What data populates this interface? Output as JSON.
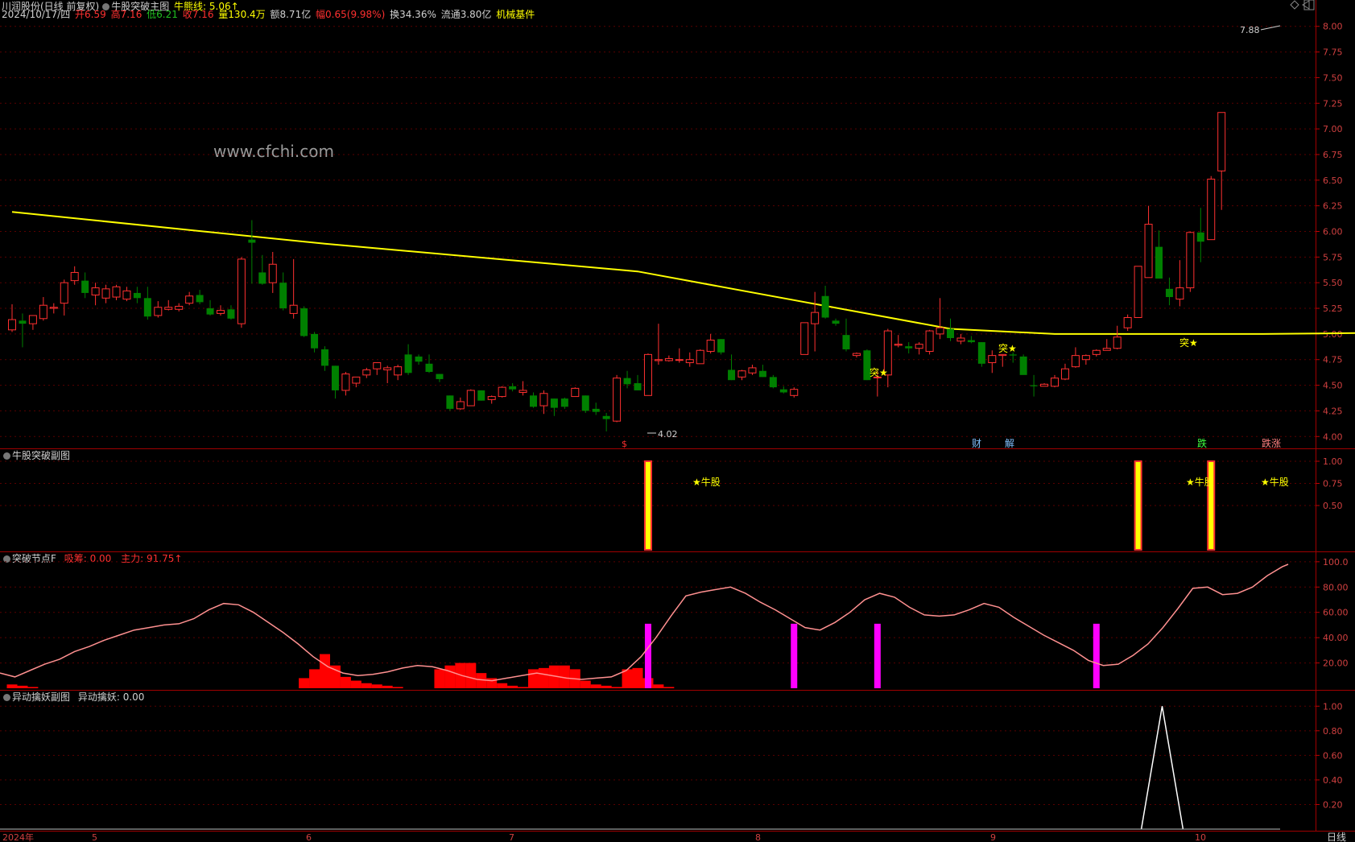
{
  "header": {
    "stock": "川润股份(日线 前复权)",
    "main_indicator": "牛股突破主图",
    "bull_line": "牛熊线: 5.06↑",
    "date": "2024/10/17/四",
    "open": "开6.59",
    "high": "高7.16",
    "low": "低6.21",
    "close": "收7.16",
    "volume": "量130.4万",
    "amount": "额8.71亿",
    "change": "幅0.65(9.98%)",
    "turnover": "换34.36%",
    "float": "流通3.80亿",
    "sector": "机械基件"
  },
  "watermark": "www.cfchi.com",
  "annotations": {
    "max_price": "7.88",
    "min_price": "4.02",
    "breakout": "突★",
    "bull": "★牛股",
    "tags": [
      "$",
      "财",
      "解",
      "跌",
      "跌涨"
    ]
  },
  "panels": {
    "sub1_title": "牛股突破副图",
    "sub2_title": "突破节点F",
    "sub2_values": [
      "吸筹: 0.00",
      "主力: 91.75↑"
    ],
    "sub3_title": "异动擒妖副图",
    "sub3_value": "异动擒妖: 0.00"
  },
  "x_axis": {
    "labels": [
      "2024年",
      "5",
      "6",
      "7",
      "8",
      "9",
      "10"
    ],
    "period_label": "日线"
  },
  "colors": {
    "up": "#ff3030",
    "down": "#008000",
    "ma": "#ffff00",
    "magenta": "#ff00ff",
    "axis": "#c00000"
  },
  "chart_data": [
    {
      "type": "candlestick",
      "title": "牛股突破主图",
      "ylim": [
        3.9,
        8.1
      ],
      "y_ticks": [
        4.0,
        4.25,
        4.5,
        4.75,
        5.0,
        5.25,
        5.5,
        5.75,
        6.0,
        6.25,
        6.5,
        6.75,
        7.0,
        7.25,
        7.5,
        7.75,
        8.0
      ],
      "ohlc": [
        [
          5.04,
          5.29,
          5.02,
          5.14
        ],
        [
          5.13,
          5.2,
          4.87,
          5.1
        ],
        [
          5.1,
          5.14,
          5.04,
          5.18
        ],
        [
          5.15,
          5.36,
          5.13,
          5.28
        ],
        [
          5.25,
          5.3,
          5.2,
          5.26
        ],
        [
          5.3,
          5.53,
          5.18,
          5.5
        ],
        [
          5.52,
          5.66,
          5.48,
          5.6
        ],
        [
          5.52,
          5.6,
          5.35,
          5.4
        ],
        [
          5.38,
          5.5,
          5.28,
          5.45
        ],
        [
          5.35,
          5.48,
          5.3,
          5.44
        ],
        [
          5.36,
          5.48,
          5.33,
          5.46
        ],
        [
          5.34,
          5.46,
          5.32,
          5.42
        ],
        [
          5.4,
          5.46,
          5.3,
          5.35
        ],
        [
          5.35,
          5.46,
          5.14,
          5.17
        ],
        [
          5.18,
          5.32,
          5.16,
          5.26
        ],
        [
          5.24,
          5.33,
          5.23,
          5.26
        ],
        [
          5.24,
          5.3,
          5.22,
          5.27
        ],
        [
          5.3,
          5.41,
          5.28,
          5.37
        ],
        [
          5.38,
          5.43,
          5.29,
          5.31
        ],
        [
          5.25,
          5.33,
          5.18,
          5.19
        ],
        [
          5.2,
          5.28,
          5.18,
          5.23
        ],
        [
          5.24,
          5.28,
          5.14,
          5.15
        ],
        [
          5.1,
          5.75,
          5.06,
          5.73
        ],
        [
          5.92,
          6.11,
          5.49,
          5.89
        ],
        [
          5.6,
          5.77,
          5.48,
          5.49
        ],
        [
          5.5,
          5.8,
          5.4,
          5.68
        ],
        [
          5.5,
          5.6,
          5.23,
          5.25
        ],
        [
          5.2,
          5.73,
          5.15,
          5.28
        ],
        [
          5.25,
          5.27,
          4.97,
          4.98
        ],
        [
          5.0,
          5.02,
          4.82,
          4.86
        ],
        [
          4.85,
          4.88,
          4.64,
          4.69
        ],
        [
          4.69,
          4.69,
          4.37,
          4.45
        ],
        [
          4.45,
          4.63,
          4.4,
          4.61
        ],
        [
          4.52,
          4.57,
          4.48,
          4.58
        ],
        [
          4.6,
          4.67,
          4.57,
          4.65
        ],
        [
          4.66,
          4.72,
          4.6,
          4.72
        ],
        [
          4.65,
          4.69,
          4.52,
          4.67
        ],
        [
          4.6,
          4.7,
          4.55,
          4.68
        ],
        [
          4.8,
          4.9,
          4.6,
          4.62
        ],
        [
          4.78,
          4.8,
          4.7,
          4.73
        ],
        [
          4.71,
          4.8,
          4.62,
          4.63
        ],
        [
          4.61,
          4.61,
          4.53,
          4.56
        ],
        [
          4.4,
          4.4,
          4.25,
          4.27
        ],
        [
          4.27,
          4.38,
          4.26,
          4.34
        ],
        [
          4.3,
          4.46,
          4.3,
          4.45
        ],
        [
          4.45,
          4.45,
          4.35,
          4.35
        ],
        [
          4.36,
          4.4,
          4.32,
          4.39
        ],
        [
          4.39,
          4.49,
          4.38,
          4.48
        ],
        [
          4.49,
          4.52,
          4.44,
          4.46
        ],
        [
          4.43,
          4.54,
          4.4,
          4.45
        ],
        [
          4.4,
          4.43,
          4.28,
          4.29
        ],
        [
          4.3,
          4.45,
          4.22,
          4.42
        ],
        [
          4.37,
          4.37,
          4.2,
          4.28
        ],
        [
          4.37,
          4.38,
          4.27,
          4.29
        ],
        [
          4.39,
          4.48,
          4.39,
          4.47
        ],
        [
          4.4,
          4.4,
          4.23,
          4.25
        ],
        [
          4.27,
          4.33,
          4.21,
          4.24
        ],
        [
          4.2,
          4.23,
          4.05,
          4.17
        ],
        [
          4.15,
          4.6,
          4.14,
          4.57
        ],
        [
          4.57,
          4.64,
          4.47,
          4.51
        ],
        [
          4.52,
          4.6,
          4.45,
          4.45
        ],
        [
          4.4,
          4.81,
          4.4,
          4.8
        ],
        [
          4.74,
          5.1,
          4.7,
          4.75
        ],
        [
          4.74,
          4.79,
          4.73,
          4.76
        ],
        [
          4.75,
          4.86,
          4.72,
          4.75
        ],
        [
          4.72,
          4.82,
          4.68,
          4.75
        ],
        [
          4.71,
          4.85,
          4.71,
          4.84
        ],
        [
          4.83,
          5.0,
          4.81,
          4.94
        ],
        [
          4.95,
          4.95,
          4.8,
          4.82
        ],
        [
          4.65,
          4.8,
          4.55,
          4.55
        ],
        [
          4.58,
          4.65,
          4.55,
          4.64
        ],
        [
          4.62,
          4.7,
          4.6,
          4.67
        ],
        [
          4.64,
          4.7,
          4.58,
          4.58
        ],
        [
          4.58,
          4.6,
          4.47,
          4.48
        ],
        [
          4.46,
          4.49,
          4.42,
          4.43
        ],
        [
          4.4,
          4.48,
          4.38,
          4.46
        ],
        [
          4.8,
          5.09,
          4.8,
          5.11
        ],
        [
          5.1,
          5.41,
          4.83,
          5.21
        ],
        [
          5.37,
          5.47,
          5.15,
          5.16
        ],
        [
          5.13,
          5.15,
          5.08,
          5.1
        ],
        [
          4.99,
          5.15,
          4.83,
          4.85
        ],
        [
          4.79,
          4.82,
          4.77,
          4.81
        ],
        [
          4.84,
          4.85,
          4.55,
          4.55
        ],
        [
          4.58,
          4.64,
          4.39,
          4.58
        ],
        [
          4.6,
          5.05,
          4.48,
          5.03
        ],
        [
          4.89,
          4.99,
          4.87,
          4.9
        ],
        [
          4.88,
          4.92,
          4.81,
          4.86
        ],
        [
          4.86,
          4.92,
          4.8,
          4.9
        ],
        [
          4.83,
          5.04,
          4.8,
          5.03
        ],
        [
          5.0,
          5.35,
          4.95,
          5.06
        ],
        [
          5.05,
          5.15,
          4.93,
          4.96
        ],
        [
          4.93,
          5.0,
          4.9,
          4.96
        ],
        [
          4.94,
          4.98,
          4.91,
          4.92
        ],
        [
          4.92,
          4.92,
          4.68,
          4.71
        ],
        [
          4.72,
          4.84,
          4.62,
          4.79
        ],
        [
          4.79,
          4.8,
          4.68,
          4.8
        ],
        [
          4.8,
          4.82,
          4.72,
          4.79
        ],
        [
          4.78,
          4.8,
          4.61,
          4.6
        ],
        [
          4.5,
          4.6,
          4.39,
          4.49
        ],
        [
          4.49,
          4.52,
          4.5,
          4.51
        ],
        [
          4.49,
          4.6,
          4.48,
          4.57
        ],
        [
          4.56,
          4.71,
          4.55,
          4.66
        ],
        [
          4.68,
          4.87,
          4.67,
          4.79
        ],
        [
          4.75,
          4.8,
          4.7,
          4.79
        ],
        [
          4.8,
          4.85,
          4.78,
          4.84
        ],
        [
          4.84,
          4.95,
          4.84,
          4.86
        ],
        [
          4.86,
          5.08,
          4.85,
          4.97
        ],
        [
          5.06,
          5.19,
          5.03,
          5.16
        ],
        [
          5.16,
          5.61,
          5.16,
          5.66
        ],
        [
          5.55,
          6.25,
          5.6,
          6.07
        ],
        [
          5.85,
          6.01,
          5.6,
          5.54
        ],
        [
          5.44,
          5.55,
          5.28,
          5.36
        ],
        [
          5.34,
          5.72,
          5.27,
          5.45
        ],
        [
          5.45,
          6.0,
          5.41,
          5.99
        ],
        [
          5.99,
          6.23,
          5.7,
          5.9
        ],
        [
          5.92,
          6.54,
          5.92,
          6.51
        ],
        [
          6.59,
          7.16,
          6.21,
          7.16
        ]
      ],
      "ma_line": [
        [
          0,
          6.19
        ],
        [
          30,
          5.88
        ],
        [
          60,
          5.61
        ],
        [
          90,
          5.05
        ],
        [
          100,
          5.0
        ],
        [
          120,
          5.0
        ],
        [
          130,
          5.01
        ],
        [
          140,
          5.07
        ]
      ]
    },
    {
      "type": "bar",
      "title": "牛股突破副图",
      "ylim": [
        0,
        1.1
      ],
      "y_ticks": [
        0.5,
        0.75,
        1.0
      ],
      "bars": [
        [
          61,
          1
        ],
        [
          108,
          1
        ],
        [
          115,
          1
        ]
      ]
    },
    {
      "type": "line",
      "title": "突破节点F",
      "ylim": [
        0,
        105
      ],
      "y_ticks": [
        20.0,
        40.0,
        60.0,
        80.0,
        100.0
      ],
      "line": [
        [
          0,
          12
        ],
        [
          5,
          9
        ],
        [
          10,
          14
        ],
        [
          15,
          19
        ],
        [
          20,
          23
        ],
        [
          25,
          29
        ],
        [
          30,
          33
        ],
        [
          35,
          38
        ],
        [
          40,
          42
        ],
        [
          45,
          46
        ],
        [
          50,
          48
        ],
        [
          55,
          50
        ],
        [
          60,
          51
        ],
        [
          65,
          55
        ],
        [
          70,
          62
        ],
        [
          75,
          67
        ],
        [
          80,
          66
        ],
        [
          85,
          60
        ],
        [
          90,
          52
        ],
        [
          95,
          44
        ],
        [
          100,
          35
        ],
        [
          105,
          25
        ],
        [
          110,
          17
        ],
        [
          115,
          12
        ],
        [
          120,
          10
        ],
        [
          125,
          11
        ],
        [
          130,
          13
        ],
        [
          135,
          16
        ],
        [
          140,
          18
        ],
        [
          145,
          17
        ],
        [
          150,
          14
        ],
        [
          155,
          10
        ],
        [
          160,
          7
        ],
        [
          165,
          6
        ],
        [
          170,
          8
        ],
        [
          175,
          10
        ],
        [
          180,
          12
        ],
        [
          185,
          10
        ],
        [
          190,
          8
        ],
        [
          195,
          7
        ],
        [
          200,
          8
        ],
        [
          205,
          9
        ],
        [
          210,
          14
        ],
        [
          215,
          25
        ],
        [
          220,
          40
        ],
        [
          225,
          57
        ],
        [
          230,
          73
        ],
        [
          235,
          76
        ],
        [
          240,
          78
        ],
        [
          245,
          80
        ],
        [
          250,
          75
        ],
        [
          255,
          68
        ],
        [
          260,
          62
        ],
        [
          265,
          55
        ],
        [
          270,
          48
        ],
        [
          275,
          46
        ],
        [
          280,
          52
        ],
        [
          285,
          60
        ],
        [
          290,
          70
        ],
        [
          295,
          75
        ],
        [
          300,
          72
        ],
        [
          305,
          64
        ],
        [
          310,
          58
        ],
        [
          315,
          57
        ],
        [
          320,
          58
        ],
        [
          325,
          62
        ],
        [
          330,
          67
        ],
        [
          335,
          64
        ],
        [
          340,
          56
        ],
        [
          345,
          49
        ],
        [
          350,
          42
        ],
        [
          355,
          36
        ],
        [
          360,
          30
        ],
        [
          365,
          22
        ],
        [
          370,
          18
        ],
        [
          375,
          19
        ],
        [
          380,
          26
        ],
        [
          385,
          35
        ],
        [
          390,
          48
        ],
        [
          395,
          63
        ],
        [
          400,
          79
        ],
        [
          405,
          80
        ],
        [
          410,
          74
        ],
        [
          415,
          75
        ],
        [
          420,
          80
        ],
        [
          425,
          89
        ],
        [
          430,
          96
        ],
        [
          432,
          98
        ]
      ],
      "magenta_bars": [
        [
          61,
          51
        ],
        [
          75,
          51
        ],
        [
          83,
          51
        ],
        [
          104,
          51
        ]
      ],
      "red_histogram": [
        [
          0,
          3
        ],
        [
          1,
          2
        ],
        [
          2,
          1
        ],
        [
          28,
          8
        ],
        [
          29,
          15
        ],
        [
          30,
          27
        ],
        [
          31,
          18
        ],
        [
          32,
          9
        ],
        [
          33,
          6
        ],
        [
          34,
          4
        ],
        [
          35,
          3
        ],
        [
          36,
          2
        ],
        [
          37,
          1
        ],
        [
          41,
          15
        ],
        [
          42,
          18
        ],
        [
          43,
          20
        ],
        [
          44,
          20
        ],
        [
          45,
          12
        ],
        [
          46,
          8
        ],
        [
          47,
          4
        ],
        [
          48,
          2
        ],
        [
          49,
          1
        ],
        [
          50,
          15
        ],
        [
          51,
          16
        ],
        [
          52,
          18
        ],
        [
          53,
          18
        ],
        [
          54,
          15
        ],
        [
          55,
          6
        ],
        [
          56,
          3
        ],
        [
          57,
          2
        ],
        [
          58,
          1
        ],
        [
          59,
          15
        ],
        [
          60,
          16
        ],
        [
          61,
          8
        ],
        [
          62,
          3
        ],
        [
          63,
          1
        ]
      ]
    },
    {
      "type": "line",
      "title": "异动擒妖副图",
      "ylim": [
        0,
        1.1
      ],
      "y_ticks": [
        0.2,
        0.4,
        0.6,
        0.8,
        1.0
      ],
      "spike": [
        [
          108,
          0
        ],
        [
          110,
          1
        ],
        [
          112,
          0
        ]
      ]
    }
  ]
}
